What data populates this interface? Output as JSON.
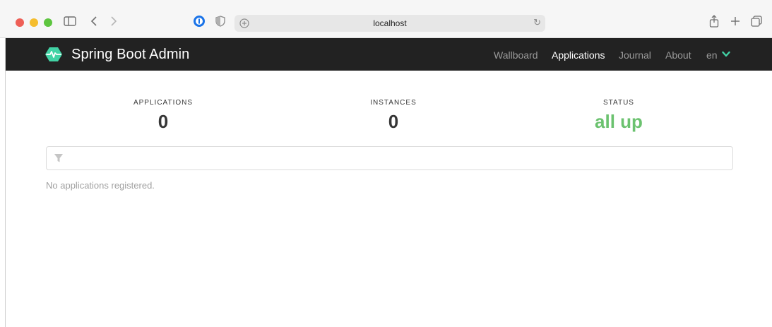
{
  "browser": {
    "url": "localhost"
  },
  "app": {
    "title": "Spring Boot Admin",
    "nav": {
      "wallboard": "Wallboard",
      "applications": "Applications",
      "journal": "Journal",
      "about": "About",
      "language": "en"
    },
    "colors": {
      "navbar": "#222222",
      "brand_green": "#42d3a5",
      "status_green": "#6bc26f"
    }
  },
  "stats": {
    "applications_label": "APPLICATIONS",
    "applications_value": "0",
    "instances_label": "INSTANCES",
    "instances_value": "0",
    "status_label": "STATUS",
    "status_value": "all up"
  },
  "filter": {
    "placeholder": ""
  },
  "empty_message": "No applications registered."
}
